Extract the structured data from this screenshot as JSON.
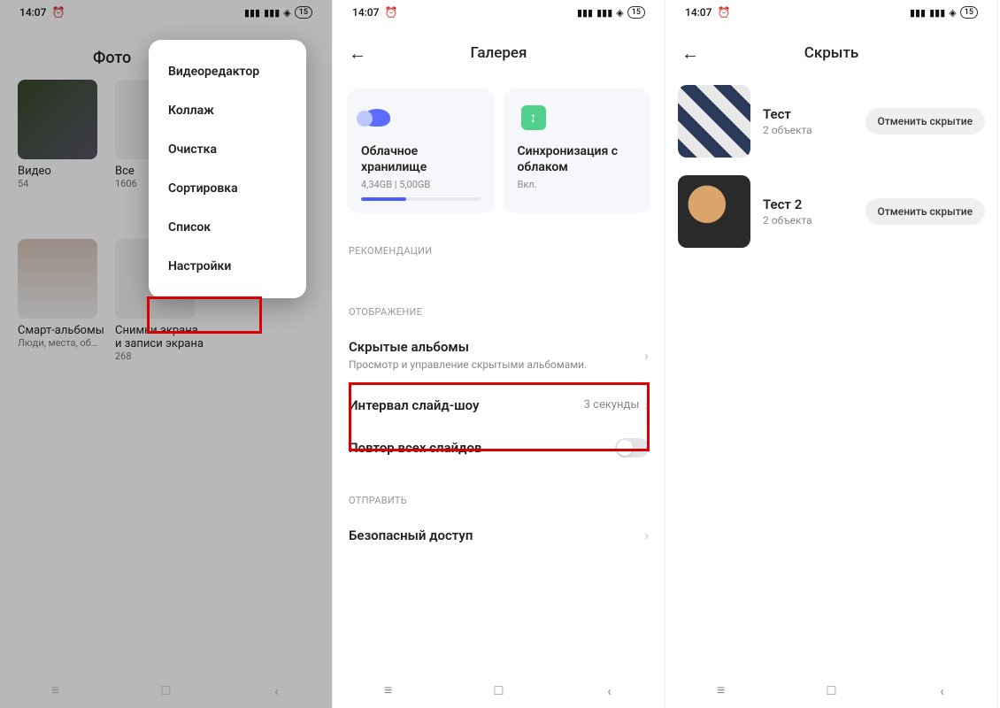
{
  "status": {
    "time": "14:07",
    "battery": "15"
  },
  "screen1": {
    "title": "Фото",
    "albums": [
      {
        "label": "Видео",
        "count": "54"
      },
      {
        "label": "Все",
        "count": "1606"
      },
      {
        "label": "Смарт-альбомы",
        "count": "Люди, места, об…"
      },
      {
        "label": "Снимки экрана и записи экрана",
        "count": "268"
      }
    ],
    "menu": [
      "Видеоредактор",
      "Коллаж",
      "Очистка",
      "Сортировка",
      "Список",
      "Настройки"
    ]
  },
  "screen2": {
    "title": "Галерея",
    "card1": {
      "title": "Облачное хранилище",
      "sub": "4,34GB | 5,00GB"
    },
    "card2": {
      "title": "Синхронизация с облаком",
      "sub": "Вкл."
    },
    "sec_reco": "РЕКОМЕНДАЦИИ",
    "sec_disp": "ОТОБРАЖЕНИЕ",
    "hidden": {
      "title": "Скрытые альбомы",
      "sub": "Просмотр и управление скрытыми альбомами."
    },
    "slideshow": {
      "title": "Интервал слайд-шоу",
      "value": "3 секунды"
    },
    "repeat": {
      "title": "Повтор всех слайдов"
    },
    "sec_send": "ОТПРАВИТЬ",
    "secure": {
      "title": "Безопасный доступ"
    }
  },
  "screen3": {
    "title": "Скрыть",
    "unhide_label": "Отменить скрытие",
    "rows": [
      {
        "name": "Тест",
        "count": "2 объекта"
      },
      {
        "name": "Тест 2",
        "count": "2 объекта"
      }
    ]
  }
}
